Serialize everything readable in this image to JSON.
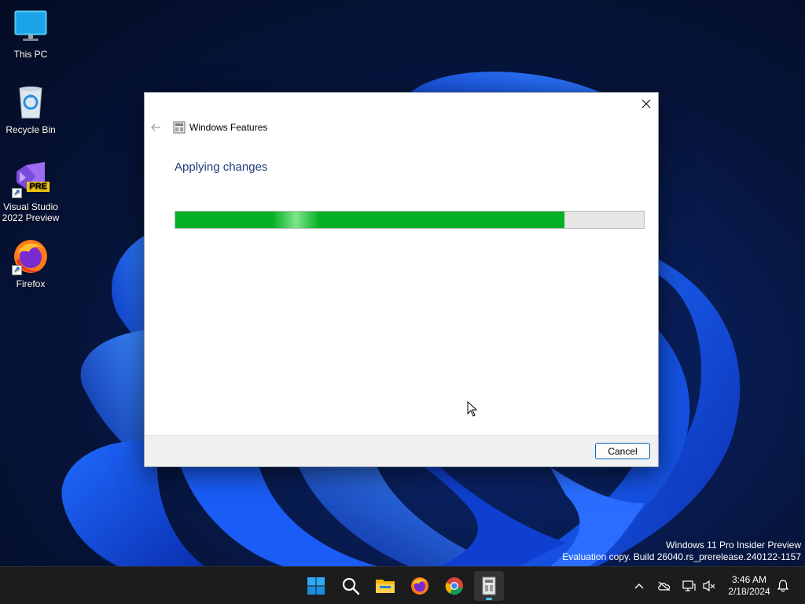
{
  "desktop": {
    "icons": [
      {
        "label": "This PC"
      },
      {
        "label": "Recycle Bin"
      },
      {
        "label": "Visual Studio 2022 Preview",
        "badge": "PRE"
      },
      {
        "label": "Firefox"
      }
    ]
  },
  "dialog": {
    "title": "Windows Features",
    "heading": "Applying changes",
    "progress_fraction": 0.83,
    "cancel_label": "Cancel"
  },
  "watermark": {
    "line1": "Windows 11 Pro Insider Preview",
    "line2": "Evaluation copy. Build 26040.rs_prerelease.240122-1157"
  },
  "taskbar": {
    "apps": [
      "start-icon",
      "search-icon",
      "file-explorer-icon",
      "firefox-icon",
      "chrome-icon",
      "windows-features-icon"
    ],
    "time": "3:46 AM",
    "date": "2/18/2024"
  },
  "colors": {
    "accent": "#0067c0",
    "progress_green": "#06b025",
    "heading_blue": "#1f3d7a"
  }
}
